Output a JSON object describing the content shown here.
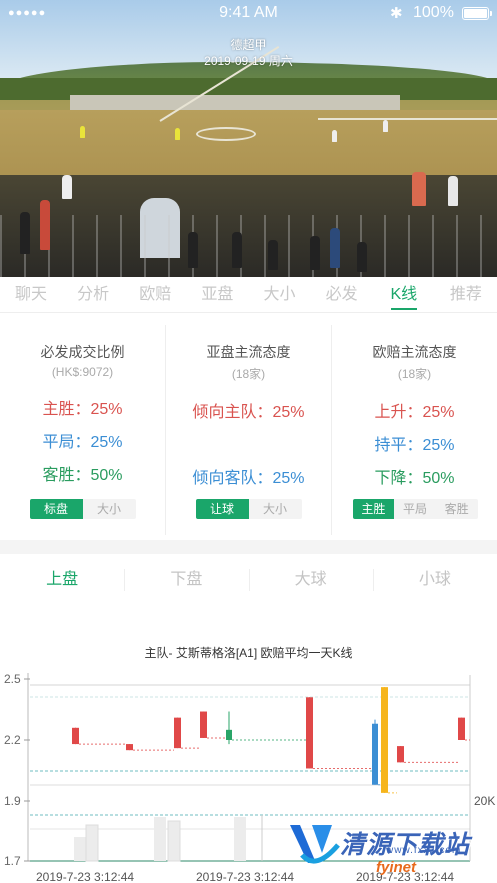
{
  "status_bar": {
    "signal": "●●●●●",
    "time": "9:41 AM",
    "bluetooth": "✱",
    "battery": "100%"
  },
  "match": {
    "league": "德超甲",
    "date": "2019-09-19  周六"
  },
  "tabs": [
    {
      "label": "聊天"
    },
    {
      "label": "分析"
    },
    {
      "label": "欧赔"
    },
    {
      "label": "亚盘"
    },
    {
      "label": "大小"
    },
    {
      "label": "必发"
    },
    {
      "label": "K线"
    },
    {
      "label": "推荐"
    }
  ],
  "active_tab": "K线",
  "stats": [
    {
      "title": "必发成交比例",
      "sub": "(HK$:9072)",
      "rows": [
        {
          "label": "主胜：",
          "value": "25%",
          "color": "#d9534f"
        },
        {
          "label": "平局：",
          "value": "25%",
          "color": "#3b8ed4"
        },
        {
          "label": "客胜：",
          "value": "50%",
          "color": "#2a9c5f"
        }
      ],
      "toggle": [
        "标盘",
        "大小"
      ],
      "toggle_active": "标盘"
    },
    {
      "title": "亚盘主流态度",
      "sub": "(18家)",
      "rows": [
        {
          "label": "倾向主队：",
          "value": "25%",
          "color": "#d9534f"
        },
        {
          "label": "",
          "value": "",
          "color": "#3b8ed4"
        },
        {
          "label": "倾向客队：",
          "value": "25%",
          "color": "#3b8ed4"
        }
      ],
      "toggle": [
        "让球",
        "大小"
      ],
      "toggle_active": "让球"
    },
    {
      "title": "欧赔主流态度",
      "sub": "(18家)",
      "rows": [
        {
          "label": "上升：",
          "value": "25%",
          "color": "#d9534f"
        },
        {
          "label": "持平：",
          "value": "25%",
          "color": "#3b8ed4"
        },
        {
          "label": "下降：",
          "value": "50%",
          "color": "#2a9c5f"
        }
      ],
      "toggle": [
        "主胜",
        "平局",
        "客胜"
      ],
      "toggle_active": "主胜"
    }
  ],
  "subtabs": [
    {
      "label": "上盘"
    },
    {
      "label": "下盘"
    },
    {
      "label": "大球"
    },
    {
      "label": "小球"
    }
  ],
  "active_subtab": "上盘",
  "chart_data": {
    "type": "candlestick",
    "title": "主队- 艾斯蒂格洛[A1] 欧赔平均一天K线",
    "y_ticks": [
      "2.5",
      "2.2",
      "1.9",
      "1.7"
    ],
    "ylim": [
      1.7,
      2.5
    ],
    "volume_label": "20K",
    "x_ticks": [
      "2019-7-23 3:12:44",
      "2019-7-23 3:12:44",
      "2019-7-23 3:12:44"
    ],
    "candles": [
      {
        "open": 2.26,
        "close": 2.18,
        "high": 2.26,
        "low": 2.18,
        "color": "#e04848"
      },
      {
        "open": 2.18,
        "close": 2.15,
        "high": 2.18,
        "low": 2.15,
        "color": "#e04848"
      },
      {
        "open": 2.31,
        "close": 2.16,
        "high": 2.31,
        "low": 2.16,
        "color": "#e04848"
      },
      {
        "open": 2.34,
        "close": 2.21,
        "high": 2.34,
        "low": 2.21,
        "color": "#e04848"
      },
      {
        "open": 2.2,
        "close": 2.25,
        "high": 2.34,
        "low": 2.18,
        "color": "#2aa568"
      },
      {
        "open": 2.41,
        "close": 2.06,
        "high": 2.41,
        "low": 2.06,
        "color": "#e04848"
      },
      {
        "open": 2.28,
        "close": 1.98,
        "high": 2.3,
        "low": 1.98,
        "color": "#3b8ed4"
      },
      {
        "open": 2.46,
        "close": 1.94,
        "high": 2.46,
        "low": 1.94,
        "color": "#f6b51c"
      },
      {
        "open": 2.17,
        "close": 2.09,
        "high": 2.17,
        "low": 2.09,
        "color": "#e04848"
      },
      {
        "open": 2.31,
        "close": 2.2,
        "high": 2.31,
        "low": 2.2,
        "color": "#e04848"
      }
    ],
    "volume": [
      0.3,
      0.45,
      0.55,
      0.5,
      0.55
    ]
  },
  "watermark": {
    "name": "清源下载站",
    "url": "www.fxxz.com",
    "tag": "fyinet"
  }
}
